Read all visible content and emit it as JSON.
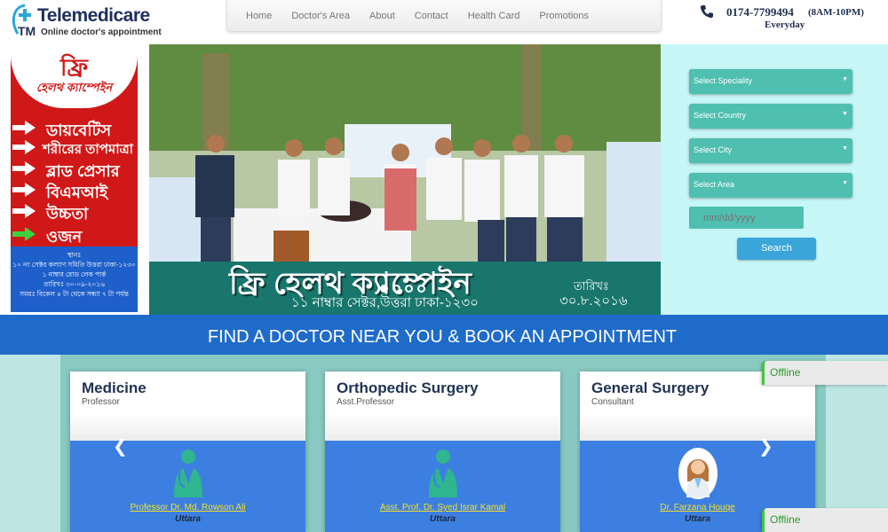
{
  "header": {
    "logo_title": "Telemedicare",
    "logo_subtitle": "Online doctor's appointment",
    "nav": [
      "Home",
      "Doctor's Area",
      "About",
      "Contact",
      "Health Card",
      "Promotions"
    ],
    "phone_number": "0174-7799494",
    "phone_hours": "(8AM-10PM)",
    "phone_days": "Everyday"
  },
  "poster": {
    "free": "ফ্রি",
    "campaign": "হেলথ ক্যাম্পেইন",
    "items": [
      "ডায়বেটিস",
      "শরীরের তাপমাত্রা",
      "ব্লাড প্রেসার",
      "বিএমআই",
      "উচ্চতা",
      "ওজন"
    ],
    "venue_label": "স্থানঃ",
    "venue": "১০ নং সেক্টর কল্যাণ সমিতি উত্তরা ঢাকা-১২৩০",
    "venue2": "১ নাম্বার রোড লেক পার্ক",
    "date": "তারিখঃ ৩০-০৯-২০১৬",
    "time": "সময়ঃ বিকেল ৪ টা থেকে সন্ধ্যা ৭ টা পর্যন্ত"
  },
  "slide": {
    "title": "ফ্রি হেলথ ক্যাম্পেইন",
    "subtitle": "১১ নাম্বার সেক্টর,উত্তরা ঢাকা-১২৩০",
    "date_label": "তারিখঃ",
    "date": "৩০.৮.২০১৬"
  },
  "search": {
    "speciality": "Select Speciality",
    "country": "Select Country",
    "city": "Select City",
    "area": "Select Area",
    "date_placeholder": "mm/dd/yyyy",
    "button": "Search"
  },
  "banner": "FIND A DOCTOR NEAR YOU & BOOK AN APPOINTMENT",
  "cards": [
    {
      "title": "Medicine",
      "role": "Professor",
      "doctor": "Professor Dr. Md. Rowson Ali",
      "location": "Uttara",
      "icon": "doctor-silhouette-icon"
    },
    {
      "title": "Orthopedic Surgery",
      "role": "Asst.Professor",
      "doctor": "Asst. Prof. Dr. Syed Israr Kamal",
      "location": "Uttara",
      "icon": "doctor-silhouette-icon"
    },
    {
      "title": "General Surgery",
      "role": "Consultant",
      "doctor": "Dr. Farzana Houqe",
      "location": "Uttara",
      "icon": "female-doctor-icon"
    }
  ],
  "chat": {
    "status1": "Offline",
    "status2": "Offline"
  },
  "colors": {
    "brand_blue": "#1f6bc9",
    "teal": "#4fbfb0",
    "poster_red": "#d01818"
  }
}
